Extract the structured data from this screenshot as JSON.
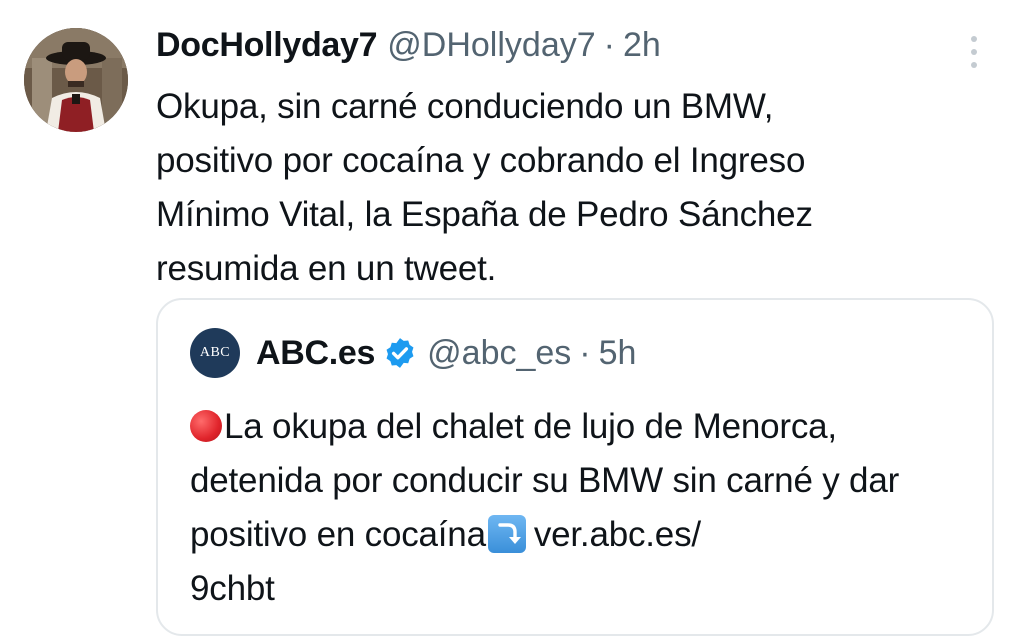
{
  "tweet": {
    "display_name": "DocHollyday7",
    "handle": "@DHollyday7",
    "separator": "·",
    "time": "2h",
    "text": "Okupa, sin carné conduciendo un BMW,\npositivo por cocaína y cobrando el Ingreso\nMínimo Vital, la España de Pedro Sánchez\nresumida en un tweet.",
    "avatar_icon": "cowboy-avatar",
    "more_icon": "more-vertical-icon"
  },
  "quote": {
    "avatar_text": "ABC",
    "display_name": "ABC.es",
    "verified_icon": "verified-badge-icon",
    "handle": "@abc_es",
    "separator": "·",
    "time": "5h",
    "text_part1": "La okupa del chalet de lujo de Menorca, detenida por conducir su BMW sin carné y dar positivo en cocaína",
    "text_link": "ver.abc.es/\n9chbt",
    "emoji_start": "red-circle-emoji",
    "emoji_mid": "arrow-curving-down-emoji"
  },
  "colors": {
    "text_primary": "#0f1419",
    "text_secondary": "#536471",
    "border": "#e4e8eb",
    "verified_blue": "#1d9bf0",
    "abc_navy": "#1f3a5a"
  }
}
